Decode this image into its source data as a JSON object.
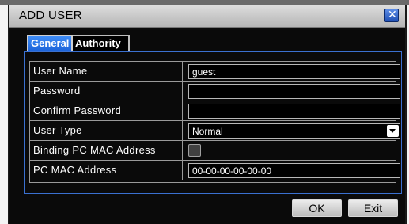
{
  "dialog": {
    "title": "ADD USER",
    "close_icon": "close-icon"
  },
  "tabs": [
    {
      "label": "General",
      "active": true
    },
    {
      "label": "Authority",
      "active": false
    }
  ],
  "form": {
    "user_name": {
      "label": "User Name",
      "value": "guest"
    },
    "password": {
      "label": "Password",
      "value": ""
    },
    "confirm_password": {
      "label": "Confirm Password",
      "value": ""
    },
    "user_type": {
      "label": "User Type",
      "value": "Normal"
    },
    "binding_mac": {
      "label": "Binding PC MAC Address",
      "checked": false
    },
    "pc_mac": {
      "label": "PC MAC Address",
      "value": "00-00-00-00-00-00"
    }
  },
  "buttons": {
    "ok": "OK",
    "exit": "Exit"
  },
  "colors": {
    "accent_blue": "#1b62d9",
    "panel_border": "#3a70d0",
    "background": "#0a0a0a"
  }
}
